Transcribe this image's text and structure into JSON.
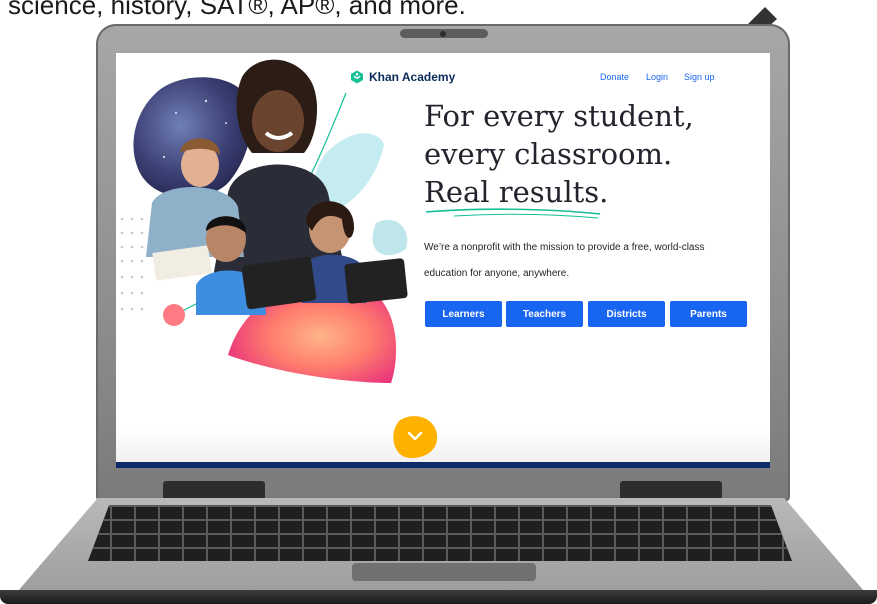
{
  "caption": "science, history, SAT®, AP®, and more.",
  "site": {
    "brand": "Khan Academy",
    "nav": {
      "donate": "Donate",
      "login": "Login",
      "signup": "Sign up"
    },
    "headline": [
      "For every student,",
      "every classroom.",
      "Real results."
    ],
    "subtext": "We’re a nonprofit with the mission to provide a free, world-class education for anyone, anywhere.",
    "buttons": [
      "Learners",
      "Teachers",
      "Districts",
      "Parents"
    ]
  },
  "icons": {
    "arrow": "pointer-arrow-icon",
    "logo": "khan-logo-icon",
    "scroll": "chevron-down-icon"
  },
  "colors": {
    "brand_blue": "#1865f2",
    "headline": "#21242c",
    "accent_green": "#14bf96",
    "scroll_button": "#ffb100"
  }
}
